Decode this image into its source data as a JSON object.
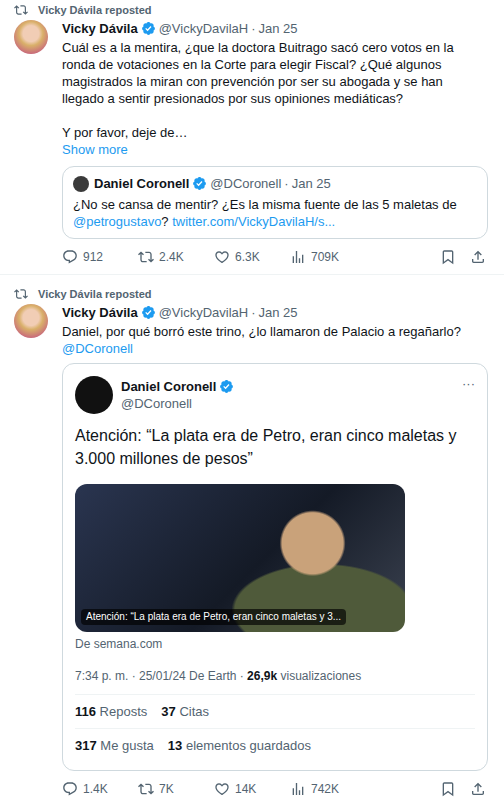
{
  "posts": [
    {
      "repost_label": "Vicky Dávila reposted",
      "author": {
        "name": "Vicky Dávila",
        "handle": "@VickyDavilaH",
        "verified": true
      },
      "separator": "·",
      "date": "Jan 25",
      "paragraphs": [
        [
          {
            "text": "Cuál es a la mentira, ¿que la doctora Buitrago sacó cero votos en la ronda de votaciones en la Corte para elegir Fiscal? ¿Qué algunos magistrados la miran con prevención por ser su abogada y se han llegado a sentir presionados por sus opiniones mediáticas?",
            "link": false
          }
        ],
        [
          {
            "text": "Y por favor, deje de…",
            "link": false
          }
        ]
      ],
      "show_more": "Show more",
      "quote": {
        "author": {
          "name": "Daniel Coronell",
          "handle": "@DCoronell",
          "verified": true
        },
        "separator": "·",
        "date": "Jan 25",
        "segments": [
          {
            "text": "¿No se cansa de mentir? ¿Es la misma fuente de las 5 maletas de ",
            "link": false
          },
          {
            "text": "@petrogustavo",
            "link": true
          },
          {
            "text": "? ",
            "link": false
          },
          {
            "text": "twitter.com/VickyDavilaH/s...",
            "link": true
          }
        ]
      },
      "embed": null,
      "actions": [
        {
          "kind": "reply",
          "count": "912"
        },
        {
          "kind": "repost",
          "count": "2.4K"
        },
        {
          "kind": "like",
          "count": "6.3K"
        },
        {
          "kind": "views",
          "count": "709K"
        },
        {
          "kind": "bookmark",
          "count": ""
        },
        {
          "kind": "share",
          "count": ""
        }
      ]
    },
    {
      "repost_label": "Vicky Dávila reposted",
      "author": {
        "name": "Vicky Dávila",
        "handle": "@VickyDavilaH",
        "verified": true
      },
      "separator": "·",
      "date": "Jan 25",
      "paragraphs": [
        [
          {
            "text": "Daniel, por qué borró este trino, ¿lo llamaron de Palacio a regañarlo? ",
            "link": false
          },
          {
            "text": "@DCoronell",
            "link": true
          }
        ]
      ],
      "show_more": "",
      "quote": null,
      "embed": {
        "author": {
          "name": "Daniel Coronell",
          "handle": "@DCoronell",
          "verified": true
        },
        "more": "···",
        "text": "Atención: “La plata era de Petro, eran cinco maletas y 3.000 millones de pesos”",
        "card": {
          "caption": "Atención: “La plata era de Petro, eran cinco maletas y 3...",
          "source": "De semana.com"
        },
        "meta": [
          {
            "text": "7:34 p. m. · 25/01/24 De Earth · ",
            "bold": false
          },
          {
            "text": "26,9k",
            "bold": true
          },
          {
            "text": " visualizaciones",
            "bold": false
          }
        ],
        "stats": [
          [
            {
              "value": "116",
              "label": "Reposts"
            },
            {
              "value": "37",
              "label": "Citas"
            }
          ],
          [
            {
              "value": "317",
              "label": "Me gusta"
            },
            {
              "value": "13",
              "label": "elementos guardados"
            }
          ]
        ]
      },
      "actions": [
        {
          "kind": "reply",
          "count": "1.4K"
        },
        {
          "kind": "repost",
          "count": "7K"
        },
        {
          "kind": "like",
          "count": "14K"
        },
        {
          "kind": "views",
          "count": "742K"
        },
        {
          "kind": "bookmark",
          "count": ""
        },
        {
          "kind": "share",
          "count": ""
        }
      ]
    }
  ]
}
